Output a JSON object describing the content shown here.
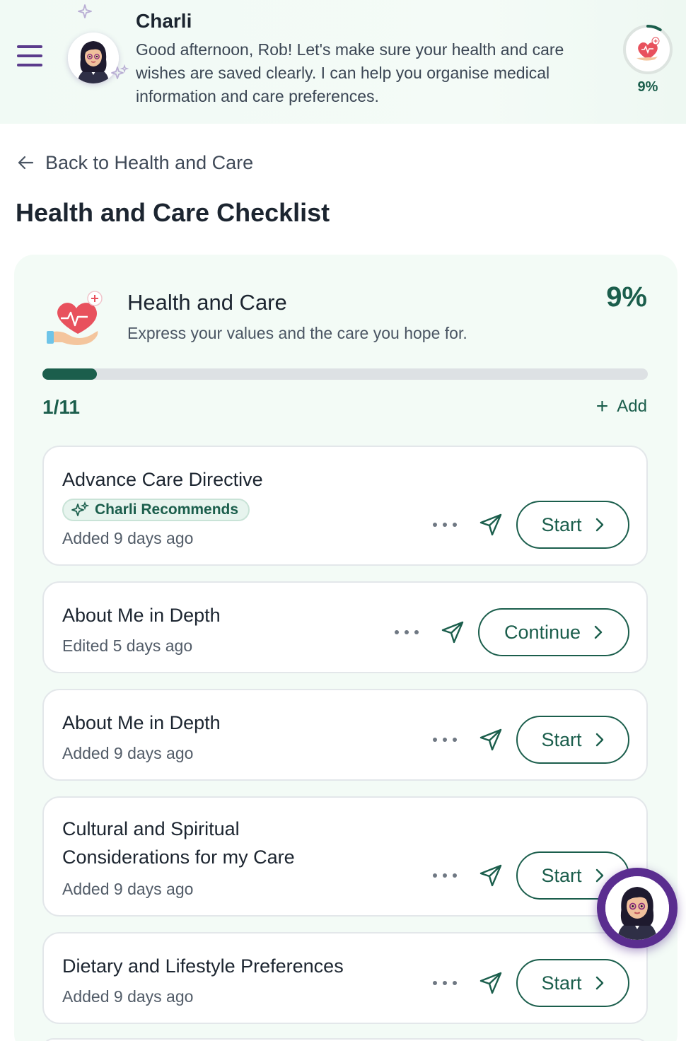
{
  "header": {
    "assistant_name": "Charli",
    "message": "Good afternoon, Rob! Let's make sure your health and care wishes are saved clearly. I can help you organise medical information and care preferences.",
    "progress_label": "9%",
    "progress_value": 0.09
  },
  "nav": {
    "back_label": "Back to Health and Care"
  },
  "page": {
    "title": "Health and Care Checklist"
  },
  "section": {
    "title": "Health and Care",
    "subtitle": "Express your values and the care you hope for.",
    "percent_label": "9%",
    "progress_value": 0.09,
    "count_label": "1/11",
    "add_label": "Add"
  },
  "items": [
    {
      "title_lines": [
        "Advance Care Directive"
      ],
      "badge": "Charli Recommends",
      "meta": "Added 9 days ago",
      "action": "Start"
    },
    {
      "title_lines": [
        "About Me in Depth"
      ],
      "meta": "Edited 5 days ago",
      "action": "Continue"
    },
    {
      "title_lines": [
        "About Me in Depth"
      ],
      "meta": "Added 9 days ago",
      "action": "Start"
    },
    {
      "title_lines": [
        "Cultural and Spiritual",
        "Considerations for my Care"
      ],
      "meta": "Added 9 days ago",
      "action": "Start"
    },
    {
      "title_lines": [
        "Dietary and Lifestyle Preferences"
      ],
      "meta": "Added 9 days ago",
      "action": "Start"
    }
  ],
  "colors": {
    "accent": "#1b5e4c",
    "assistant_purple": "#5a2d8f",
    "menu_purple": "#5b3b8c",
    "heart_red": "#e8515d"
  },
  "icons": {
    "menu": "hamburger-menu-icon",
    "back": "arrow-left-icon",
    "send": "send-icon",
    "more": "more-dots-icon",
    "chevron": "chevron-right-icon",
    "badge": "sparkle-icon",
    "section": "heart-hand-icon"
  }
}
